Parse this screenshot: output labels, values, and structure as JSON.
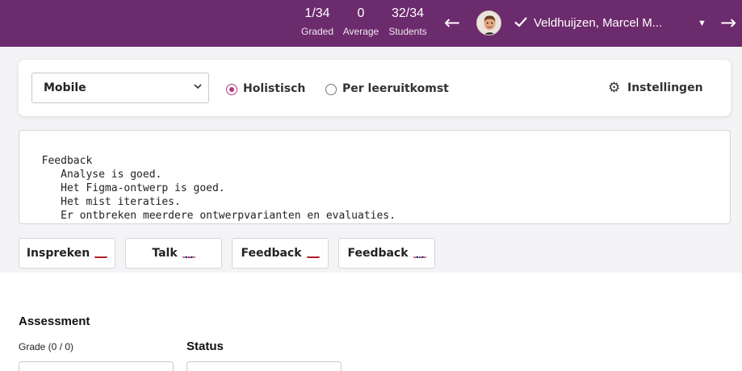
{
  "header": {
    "stats": [
      {
        "value": "1/34",
        "label": "Graded"
      },
      {
        "value": "0",
        "label": "Average"
      },
      {
        "value": "32/34",
        "label": "Students"
      }
    ],
    "prev_icon": "arrow-left-icon",
    "next_icon": "arrow-right-icon",
    "student": {
      "name": "Veldhuijzen, Marcel M...",
      "graded_icon": "check-icon",
      "dropdown_icon": "caret-down-icon"
    },
    "background_color": "#6c2b6c"
  },
  "settings": {
    "criteria_select": {
      "selected": "Mobile"
    },
    "mode_options": [
      {
        "label": "Holistisch",
        "selected": true
      },
      {
        "label": "Per leeruitkomst",
        "selected": false
      }
    ],
    "settings_button": {
      "label": "Instellingen",
      "icon": "gear-icon"
    }
  },
  "feedback": {
    "text": "Feedback\n     Analyse is goed.\n     Het Figma-ontwerp is goed.\n     Het mist iteraties.\n     Er ontbreken meerdere ontwerpvarianten en evaluaties."
  },
  "quick_buttons": [
    {
      "label": "Inspreken",
      "flag": "nl-flag-icon"
    },
    {
      "label": "Talk",
      "flag": "uk-flag-icon"
    },
    {
      "label": "Feedback",
      "flag": "nl-flag-icon"
    },
    {
      "label": "Feedback",
      "flag": "uk-flag-icon"
    }
  ],
  "assessment": {
    "title": "Assessment",
    "grade_label": "Grade (0 / 0)",
    "status_label": "Status"
  },
  "colors": {
    "accent": "#b03a7c",
    "header": "#6c2b6c"
  }
}
